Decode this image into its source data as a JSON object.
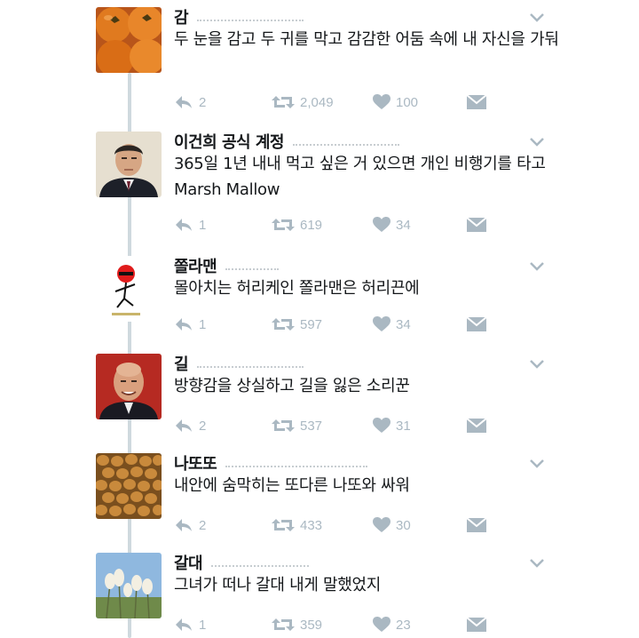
{
  "colors": {
    "action_gray": "#aab8c2",
    "thread_line": "#cfd9de",
    "text": "#14171a"
  },
  "tweets": [
    {
      "name": "감",
      "text": "두 눈을 감고 두 귀를 막고 감감한 어둠 속에 내 자신을 가둬",
      "replies": "2",
      "retweets": "2,049",
      "likes": "100",
      "avatar": "persimmons"
    },
    {
      "name": "이건희 공식 계정",
      "text": "365일 1년 내내 먹고 싶은 거 있으면 개인 비행기를 타고 Marsh Mallow",
      "replies": "1",
      "retweets": "619",
      "likes": "34",
      "avatar": "businessman"
    },
    {
      "name": "쫄라맨",
      "text": "몰아치는 허리케인 쫄라맨은 허리끈에",
      "replies": "1",
      "retweets": "597",
      "likes": "34",
      "avatar": "stick-figure"
    },
    {
      "name": "길",
      "text": "방향감을 상실하고 길을 잃은 소리꾼",
      "replies": "2",
      "retweets": "537",
      "likes": "31",
      "avatar": "bald-man"
    },
    {
      "name": "나또또",
      "text": "내안에 숨막히는 또다른 나또와 싸워",
      "replies": "2",
      "retweets": "433",
      "likes": "30",
      "avatar": "natto-beans"
    },
    {
      "name": "갈대",
      "text": "그녀가 떠나 갈대 내게 말했었지",
      "replies": "1",
      "retweets": "359",
      "likes": "23",
      "avatar": "reeds"
    }
  ]
}
